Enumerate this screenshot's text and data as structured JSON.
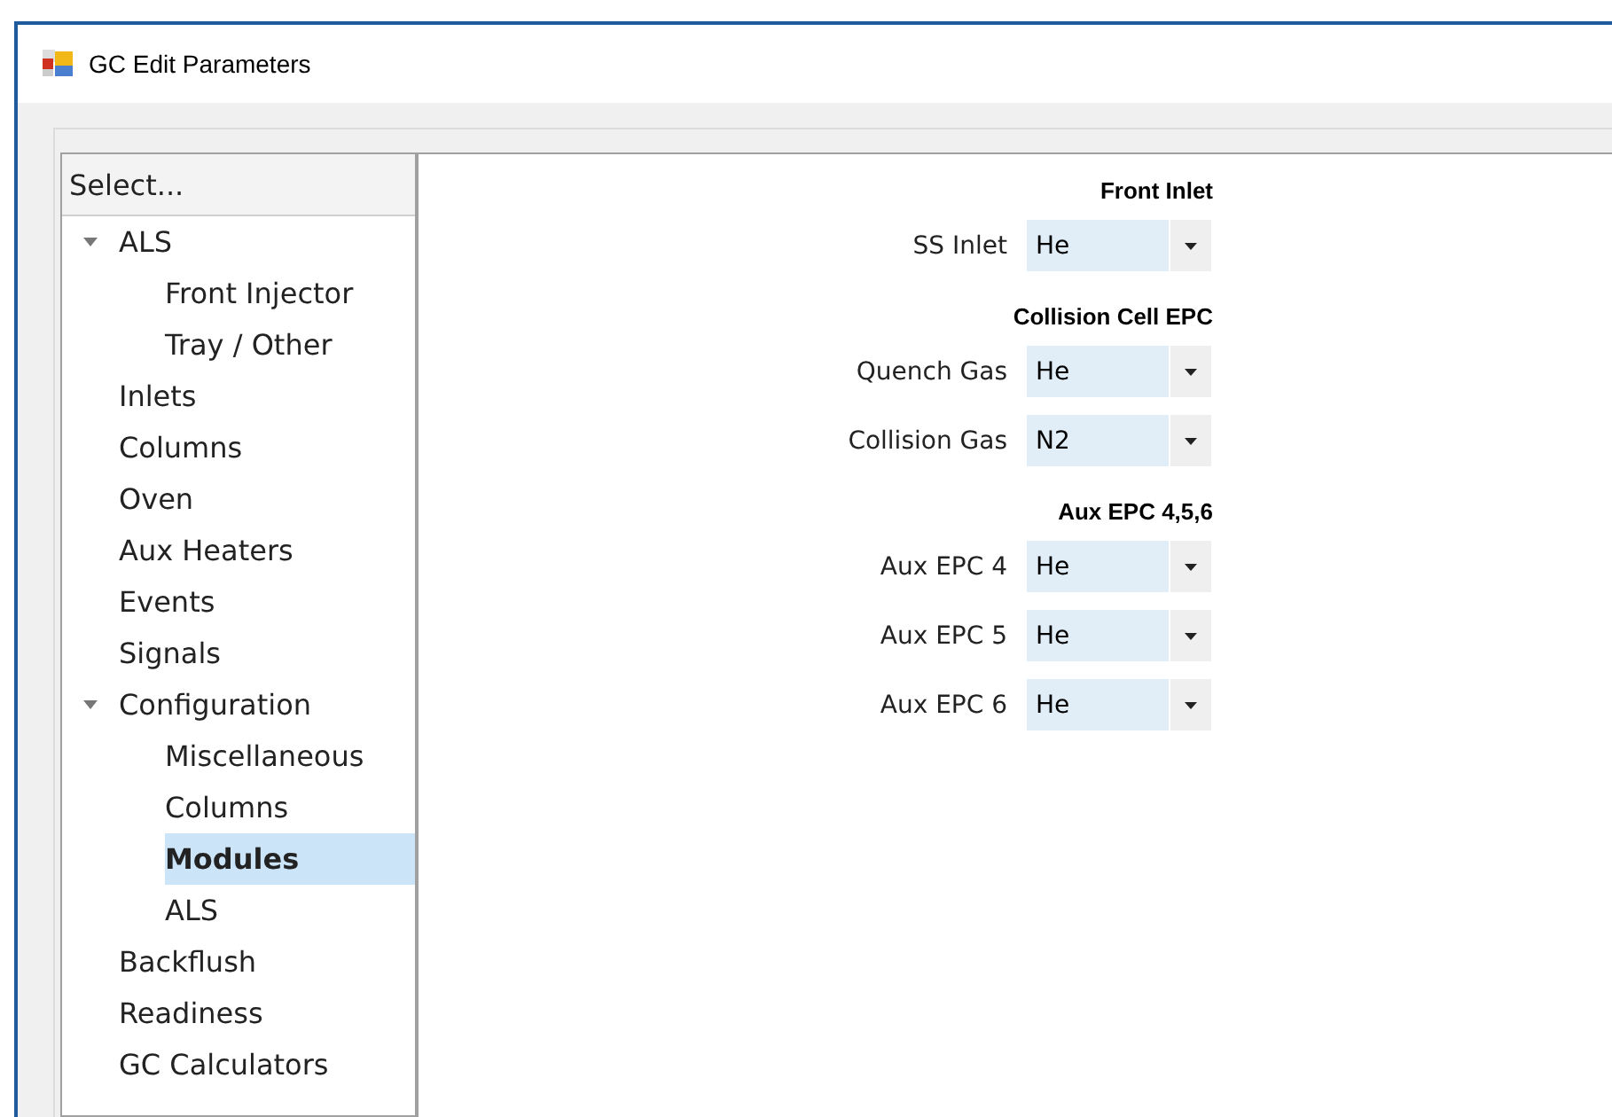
{
  "window": {
    "title": "GC Edit Parameters"
  },
  "tree": {
    "header": "Select...",
    "items": [
      {
        "label": "ALS",
        "expanded": true,
        "selected": false,
        "children": [
          {
            "label": "Front Injector",
            "selected": false
          },
          {
            "label": "Tray / Other",
            "selected": false
          }
        ]
      },
      {
        "label": "Inlets",
        "selected": false
      },
      {
        "label": "Columns",
        "selected": false
      },
      {
        "label": "Oven",
        "selected": false
      },
      {
        "label": "Aux Heaters",
        "selected": false
      },
      {
        "label": "Events",
        "selected": false
      },
      {
        "label": "Signals",
        "selected": false
      },
      {
        "label": "Configuration",
        "expanded": true,
        "selected": false,
        "children": [
          {
            "label": "Miscellaneous",
            "selected": false
          },
          {
            "label": "Columns",
            "selected": false
          },
          {
            "label": "Modules",
            "selected": true
          },
          {
            "label": "ALS",
            "selected": false
          }
        ]
      },
      {
        "label": "Backflush",
        "selected": false
      },
      {
        "label": "Readiness",
        "selected": false
      },
      {
        "label": "GC Calculators",
        "selected": false
      }
    ]
  },
  "sections": [
    {
      "title": "Front Inlet",
      "fields": [
        {
          "label": "SS Inlet",
          "value": "He"
        }
      ]
    },
    {
      "title": "Collision Cell EPC",
      "fields": [
        {
          "label": "Quench Gas",
          "value": "He"
        },
        {
          "label": "Collision Gas",
          "value": "N2"
        }
      ]
    },
    {
      "title": "Aux EPC 4,5,6",
      "fields": [
        {
          "label": "Aux EPC 4",
          "value": "He"
        },
        {
          "label": "Aux EPC 5",
          "value": "He"
        },
        {
          "label": "Aux EPC 6",
          "value": "He"
        }
      ]
    }
  ]
}
